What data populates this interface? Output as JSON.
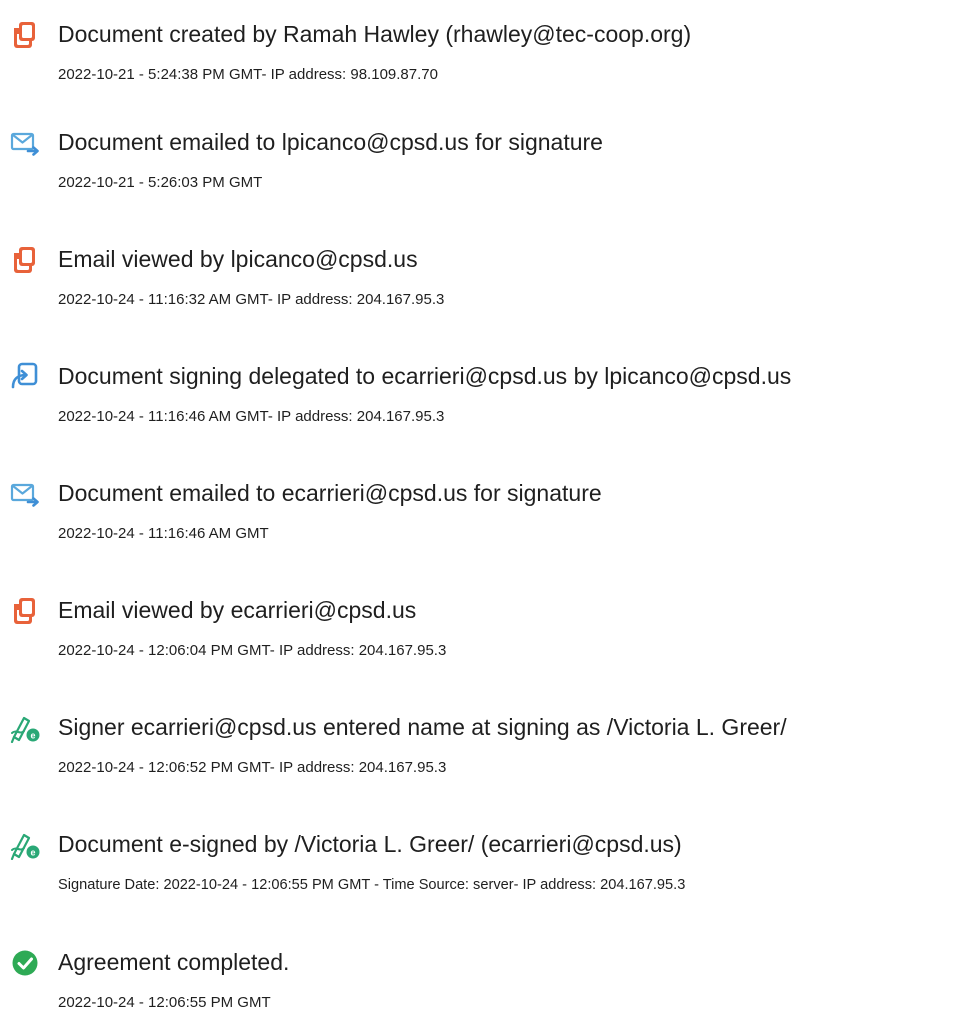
{
  "colors": {
    "doc_orange": "#e8623a",
    "mail_blue": "#5aa8dc",
    "delegate_blue": "#3f8fd6",
    "sign_green": "#2aa876",
    "check_green": "#2eaa55"
  },
  "events": [
    {
      "icon": "document-icon",
      "title": "Document created by Ramah Hawley (rhawley@tec-coop.org)",
      "meta": "2022-10-21 - 5:24:38 PM GMT- IP address: 98.109.87.70"
    },
    {
      "icon": "email-icon",
      "title": "Document emailed to lpicanco@cpsd.us for signature",
      "meta": "2022-10-21 - 5:26:03 PM GMT"
    },
    {
      "icon": "document-icon",
      "title": "Email viewed by lpicanco@cpsd.us",
      "meta": "2022-10-24 - 11:16:32 AM GMT- IP address: 204.167.95.3"
    },
    {
      "icon": "delegate-icon",
      "title": "Document signing delegated to ecarrieri@cpsd.us by lpicanco@cpsd.us",
      "meta": "2022-10-24 - 11:16:46 AM GMT- IP address: 204.167.95.3"
    },
    {
      "icon": "email-icon",
      "title": "Document emailed to ecarrieri@cpsd.us for signature",
      "meta": "2022-10-24 - 11:16:46 AM GMT"
    },
    {
      "icon": "document-icon",
      "title": "Email viewed by ecarrieri@cpsd.us",
      "meta": "2022-10-24 - 12:06:04 PM GMT- IP address: 204.167.95.3"
    },
    {
      "icon": "esign-pen-icon",
      "title": "Signer ecarrieri@cpsd.us entered name at signing as /Victoria L. Greer/",
      "meta": "2022-10-24 - 12:06:52 PM GMT- IP address: 204.167.95.3"
    },
    {
      "icon": "esign-pen-icon",
      "title": "Document e-signed by /Victoria L. Greer/ (ecarrieri@cpsd.us)",
      "meta": "Signature Date: 2022-10-24 - 12:06:55 PM GMT - Time Source: server- IP address: 204.167.95.3"
    },
    {
      "icon": "check-circle-icon",
      "title": "Agreement completed.",
      "meta": "2022-10-24 - 12:06:55 PM GMT"
    }
  ]
}
